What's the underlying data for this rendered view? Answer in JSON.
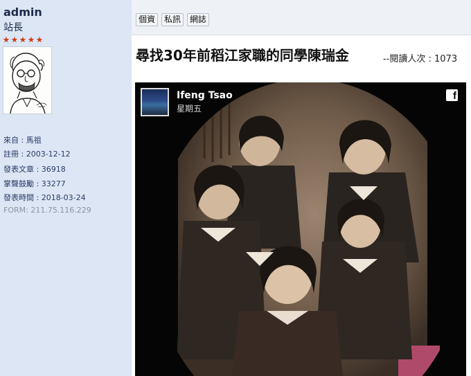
{
  "profile": {
    "username": "admin",
    "rank": "站長",
    "star_count": 5,
    "from": "來自 : 馬祖",
    "registered": "註冊 : 2003-12-12",
    "posts": "發表文章 : 36918",
    "applause": "掌聲鼓勵 : 33277",
    "post_time": "發表時間 : 2018-03-24",
    "form_ip": "FORM: 211.75.116.229"
  },
  "toolbar": {
    "profile_btn": "個資",
    "pm_btn": "私訊",
    "website_btn": "網誌"
  },
  "article": {
    "title": "尋找30年前稻江家職的同學陳瑞金",
    "reads_label": "--閱讀人次 : 1073"
  },
  "embed": {
    "author_name": "Ifeng Tsao",
    "posted_day": "星期五",
    "platform_icon": "facebook-icon",
    "platform_glyph": "f"
  },
  "colors": {
    "sidebar_bg": "#dce6f4",
    "star": "#d43a1a",
    "info_text": "#2a3b66"
  }
}
